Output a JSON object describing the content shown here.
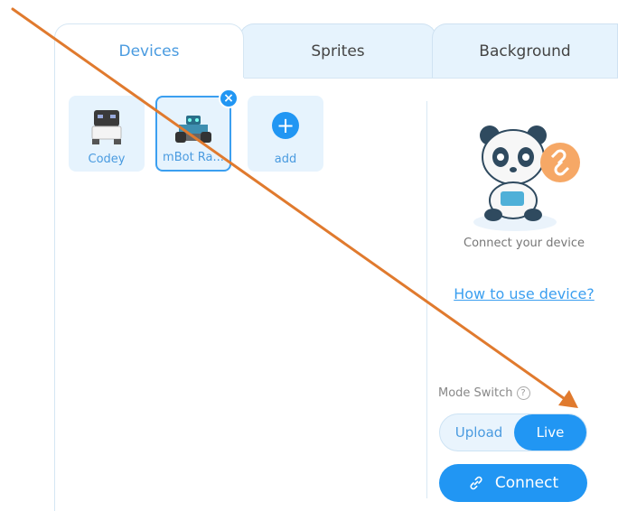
{
  "tabs": [
    {
      "label": "Devices",
      "active": true
    },
    {
      "label": "Sprites",
      "active": false
    },
    {
      "label": "Background",
      "active": false
    }
  ],
  "devices": [
    {
      "label": "Codey",
      "icon": "codey-robot-icon"
    },
    {
      "label": "mBot Ra...",
      "icon": "mbot-ranger-icon",
      "selected": true
    }
  ],
  "add_tile": {
    "label": "add",
    "symbol": "+"
  },
  "remove_symbol": "×",
  "right_panel": {
    "connect_text": "Connect your device",
    "howto_link": "How to use device?",
    "mode_label": "Mode Switch",
    "help_symbol": "?",
    "mode_upload": "Upload",
    "mode_live": "Live",
    "connect_button": "Connect"
  },
  "colors": {
    "accent": "#2196f3",
    "tab_bg": "#e6f3fd",
    "annotation_arrow": "#e07a2e"
  }
}
